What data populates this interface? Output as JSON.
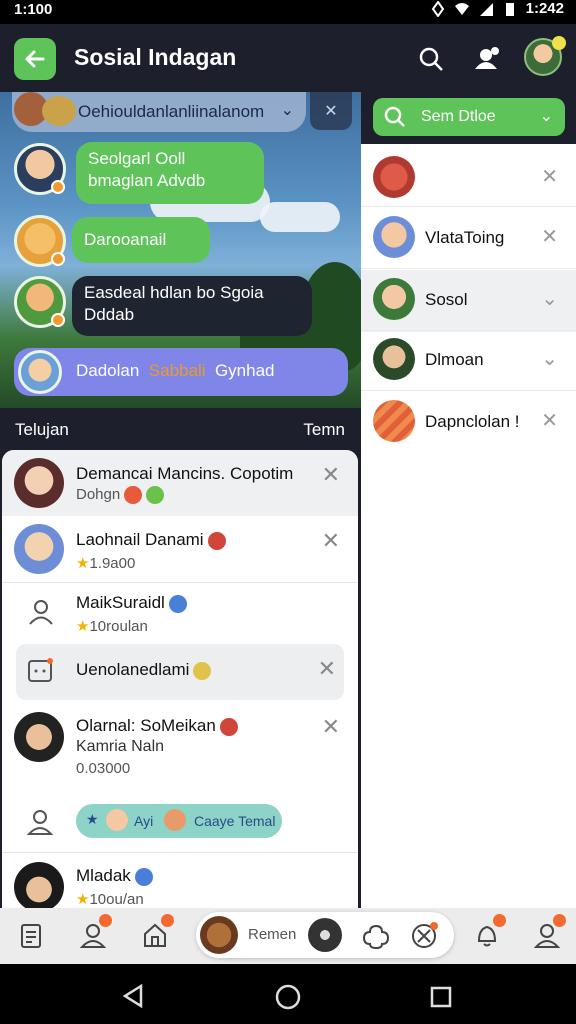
{
  "status_bar": {
    "time": "1:100",
    "right_time": "1:242"
  },
  "app_bar": {
    "title": "Sosial Indagan"
  },
  "chat": {
    "header_text": "Oehiouldanlanliinalanom",
    "messages": [
      {
        "text": "Seolgarl Ooll bmaglan Advdb"
      },
      {
        "text": "Darooanail"
      },
      {
        "text": "Easdeal hdlan bo Sgoia Dddab"
      },
      {
        "text_a": "Dadolan",
        "text_b": "Sabbali",
        "text_c": "Gynhad"
      }
    ]
  },
  "list": {
    "header_left": "Telujan",
    "header_right": "Temn",
    "rows": [
      {
        "name": "Demancai Mancins. Copotim",
        "sub": "Dohgn"
      },
      {
        "name": "Laohnail Danami",
        "sub": "1.9a00"
      },
      {
        "name": "MaikSuraidl",
        "sub": "10roulan"
      },
      {
        "name": "Uenolanedlami"
      },
      {
        "name": "Olarnal: SoMeikan",
        "sub": "Kamria Naln",
        "sub2": "0.03000"
      },
      {
        "name": "Mladak",
        "sub": "10ou/an"
      }
    ],
    "pill": {
      "a": "Ayi",
      "b": "Caaye Temal"
    }
  },
  "right_panel": {
    "search_label": "Sem Dtloe",
    "items": [
      {
        "name": ""
      },
      {
        "name": "VlataToing"
      },
      {
        "name": "Sosol"
      },
      {
        "name": "Dlmoan"
      },
      {
        "name": "Dapnclolan !"
      }
    ]
  },
  "tab_bar": {
    "center_label": "Remen"
  },
  "colors": {
    "accent_green": "#5ec45a",
    "dark_bar": "#1d1f2c",
    "bubble_purple": "#7f86e8",
    "badge_orange": "#f26a2e"
  }
}
